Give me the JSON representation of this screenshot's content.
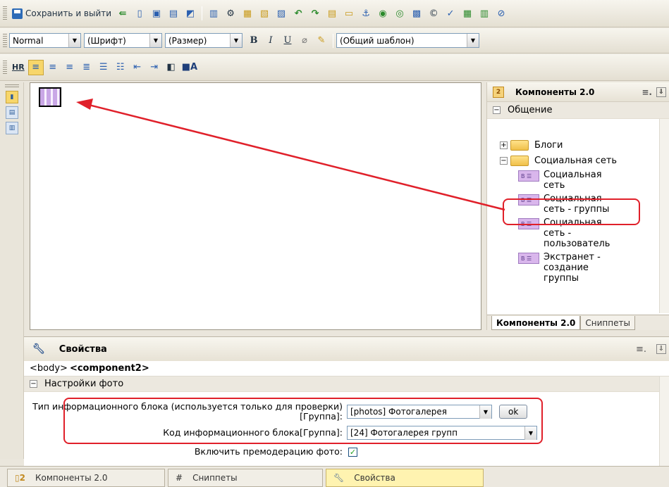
{
  "toolbar1": {
    "save_exit_label": "Сохранить и выйти"
  },
  "toolbar2": {
    "style_value": "Normal",
    "font_value": "(Шрифт)",
    "size_value": "(Размер)",
    "template_value": "(Общий шаблон)",
    "bold": "B",
    "italic": "I",
    "underline": "U"
  },
  "toolbar3": {
    "hr_label": "HR"
  },
  "components_panel": {
    "title": "Компоненты 2.0",
    "group": "Общение",
    "tree": [
      {
        "label": "Блоги",
        "toggle": "+"
      },
      {
        "label": "Социальная сеть",
        "toggle": "−"
      }
    ],
    "items": [
      {
        "label": "Социальная сеть"
      },
      {
        "label": "Социальная сеть - группы"
      },
      {
        "label": "Социальная сеть - пользователь"
      },
      {
        "label": "Экстранет - создание группы"
      }
    ],
    "tabs": [
      "Компоненты 2.0",
      "Сниппеты"
    ]
  },
  "properties": {
    "title": "Свойства",
    "crumb_body": "<body>",
    "crumb_component": "<component2>",
    "section": "Настройки фото",
    "rows": [
      {
        "label": "Тип информационного блока (используется только для проверки)[Группа]:",
        "value": "[photos] Фотогалерея",
        "button": "ok"
      },
      {
        "label": "Код информационного блока[Группа]:",
        "value": "[24] Фотогалерея групп"
      },
      {
        "label": "Включить премодерацию фото:",
        "checked": true
      }
    ]
  },
  "bottom_tabs": [
    "Компоненты 2.0",
    "Сниппеты",
    "Свойства"
  ],
  "colors": {
    "highlight": "#e0202a",
    "arrow": "#e0202a"
  }
}
